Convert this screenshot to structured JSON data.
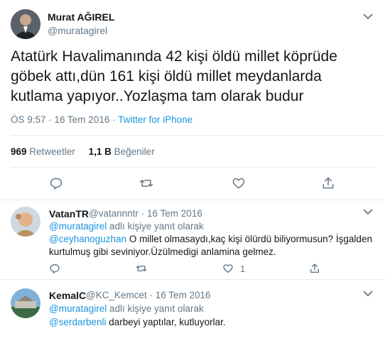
{
  "main_tweet": {
    "author_name": "Murat AĞIREL",
    "handle": "@muratagirel",
    "text": "Atatürk Havalimanında 42 kişi öldü millet köprüde göbek attı,dün 161 kişi öldü millet meydanlarda kutlama yapıyor..Yozlaşma tam olarak budur",
    "time": "ÖS 9:57 · 16 Tem 2016",
    "dot": "·",
    "source": "Twitter for iPhone",
    "retweets_count": "969",
    "retweets_label": "Retweetler",
    "likes_count": "1,1 B",
    "likes_label": "Beğeniler"
  },
  "replies": [
    {
      "name": "VatanTR",
      "handle": "@vatannntr",
      "date": "· 16 Tem 2016",
      "reply_to_mention": "@muratagirel",
      "reply_to_suffix": "adlı kişiye yanıt olarak",
      "mention": "@ceyhanoguzhan",
      "text_line1": "O millet olmasaydı,kaç kişi ölürdü biliyormusun?  İşgalden",
      "text_line2": "kurtulmuş gibi seviniyor.Üzülmedigi anlamina gelmez.",
      "like_count": "1"
    },
    {
      "name": "KemalC",
      "handle": "@KC_Kemcet",
      "date": "· 16 Tem 2016",
      "reply_to_mention": "@muratagirel",
      "reply_to_suffix": "adlı kişiye yanıt olarak",
      "mention": "@serdarbenli",
      "text_line1": "darbeyi yaptılar, kutluyorlar."
    }
  ],
  "colors": {
    "link": "#1b95e0",
    "secondary": "#657786",
    "divider": "#e6ecf0"
  },
  "icons": [
    "reply-icon",
    "retweet-icon",
    "like-icon",
    "share-icon",
    "chevron-down-icon"
  ]
}
